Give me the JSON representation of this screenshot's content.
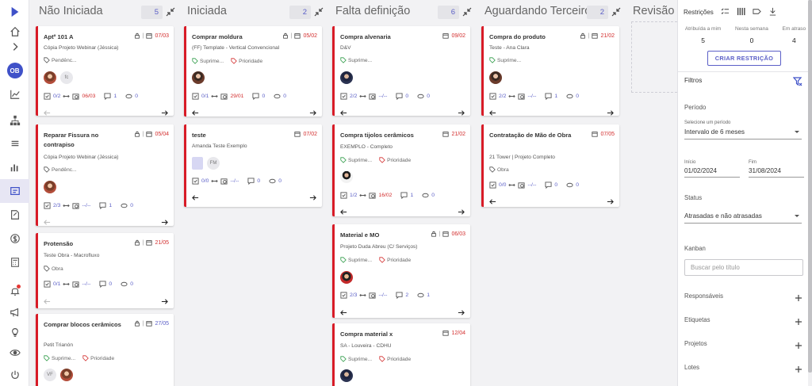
{
  "sidebar": {
    "avatar": "OB",
    "icons": [
      "logo-icon",
      "home-icon",
      "chevron-right-icon",
      "avatar",
      "chart-line-icon",
      "org-chart-icon",
      "list-icon",
      "bar-chart-icon",
      "kanban-icon",
      "document-edit-icon",
      "dollar-icon",
      "calculator-icon",
      "bell-icon",
      "megaphone-icon",
      "lightbulb-icon",
      "eye-icon",
      "power-icon"
    ]
  },
  "columns": [
    {
      "title": "Não Iniciada",
      "count": "5",
      "cards": [
        {
          "title": "Aptº 101 A",
          "date": "07/03",
          "subtitle": "Cópia Projeto Webinar (Jéssica)",
          "tags": [
            "Pendênc..."
          ],
          "people": [
            "person",
            "fc"
          ],
          "checklist": "0/2",
          "link_date": "06/03",
          "comments": "1",
          "views": "0",
          "left_dim": true
        },
        {
          "title": "Reparar Fissura no contrapiso",
          "date": "05/04",
          "subtitle": "Cópia Projeto Webinar (Jéssica)",
          "tags": [
            "Pendênc..."
          ],
          "people": [
            "person"
          ],
          "checklist": "2/3",
          "link_date": "--/--",
          "comments": "1",
          "views": "0",
          "left_dim": true
        },
        {
          "title": "Protensão",
          "date": "21/05",
          "subtitle": "Teste Obra - Macrofluxo",
          "tags": [
            "Obra"
          ],
          "people": [],
          "checklist": "0/1",
          "link_date": "--/--",
          "comments": "0",
          "views": "0",
          "left_dim": true
        },
        {
          "title": "Comprar blocos cerâmicos",
          "date": "27/05",
          "subtitle": "Petit Trianón",
          "tags": [
            "Suprime...",
            "Prioridade"
          ],
          "people": [
            "VF",
            "person"
          ]
        }
      ]
    },
    {
      "title": "Iniciada",
      "count": "2",
      "cards": [
        {
          "title": "Comprar moldura",
          "date": "05/02",
          "subtitle": "(FF) Template - Vertical Convencional",
          "tags": [
            "Suprime...",
            "Prioridade"
          ],
          "people": [
            "person"
          ],
          "checklist": "0/1",
          "link_date": "29/01",
          "comments": "0",
          "views": "0"
        },
        {
          "title": "teste",
          "date": "07/02",
          "subtitle": "Amanda Teste Exemplo",
          "tags": [],
          "people": [
            "building",
            "FM"
          ],
          "checklist": "0/0",
          "link_date": "--/--",
          "comments": "0",
          "views": "0"
        }
      ]
    },
    {
      "title": "Falta definição",
      "count": "6",
      "cards": [
        {
          "title": "Compra alvenaria",
          "date": "09/02",
          "subtitle": "D&V",
          "tags": [
            "Suprime..."
          ],
          "people": [
            "person"
          ],
          "checklist": "2/2",
          "link_date": "--/--",
          "comments": "0",
          "views": "0"
        },
        {
          "title": "Compra tijolos cerâmicos",
          "date": "21/02",
          "subtitle": "EXEMPLO - Completo",
          "tags": [
            "Suprime...",
            "Prioridade"
          ],
          "people": [
            "person"
          ],
          "checklist": "1/2",
          "link_date": "16/02",
          "comments": "1",
          "views": "0"
        },
        {
          "title": "Material e MO",
          "date": "06/03",
          "subtitle": "Projeto Duda Abreu (C/ Serviços)",
          "tags": [
            "Suprime...",
            "Prioridade"
          ],
          "people": [
            "person"
          ],
          "checklist": "2/3",
          "link_date": "--/--",
          "comments": "2",
          "views": "1"
        },
        {
          "title": "Compra material x",
          "date": "12/04",
          "subtitle": "SA - Louveira - CDHU",
          "tags": [
            "Suprime...",
            "Prioridade"
          ],
          "people": [
            "person"
          ]
        }
      ]
    },
    {
      "title": "Aguardando Terceiros",
      "count": "2",
      "cards": [
        {
          "title": "Compra do produto",
          "date": "21/02",
          "subtitle": "Teste - Ana Clara",
          "tags": [
            "Suprime..."
          ],
          "people": [
            "person"
          ],
          "checklist": "2/2",
          "link_date": "--/--",
          "comments": "1",
          "views": "0"
        },
        {
          "title": "Contratação de Mão de Obra",
          "date": "07/05",
          "subtitle": "21 Tower | Projeto Completo",
          "tags": [
            "Obra"
          ],
          "people": [],
          "checklist": "0/0",
          "link_date": "--/--",
          "comments": "0",
          "views": "0"
        }
      ]
    },
    {
      "title": "Revisão",
      "count": "",
      "cards": []
    }
  ],
  "panel": {
    "restricoes_label": "Restrições",
    "stats": [
      {
        "label": "Atribuída a mim",
        "value": "5"
      },
      {
        "label": "Nesta semana",
        "value": "0"
      },
      {
        "label": "Em atraso",
        "value": "4"
      }
    ],
    "create_button": "CRIAR RESTRIÇÃO",
    "filtros": "Filtros",
    "periodo": "Período",
    "periodo_select_label": "Selecione um período",
    "periodo_value": "Intervalo de 6 meses",
    "inicio_label": "Início",
    "inicio_value": "01/02/2024",
    "fim_label": "Fim",
    "fim_value": "31/08/2024",
    "status": "Status",
    "status_value": "Atrasadas e não atrasadas",
    "kanban": "Kanban",
    "search_placeholder": "Buscar pelo título",
    "sections": [
      "Responsáveis",
      "Etiquetas",
      "Projetos",
      "Lotes"
    ]
  },
  "colors": {
    "accent": "#5b5fc7",
    "overdue": "#d32f2f",
    "card_border": "#d81b27"
  }
}
